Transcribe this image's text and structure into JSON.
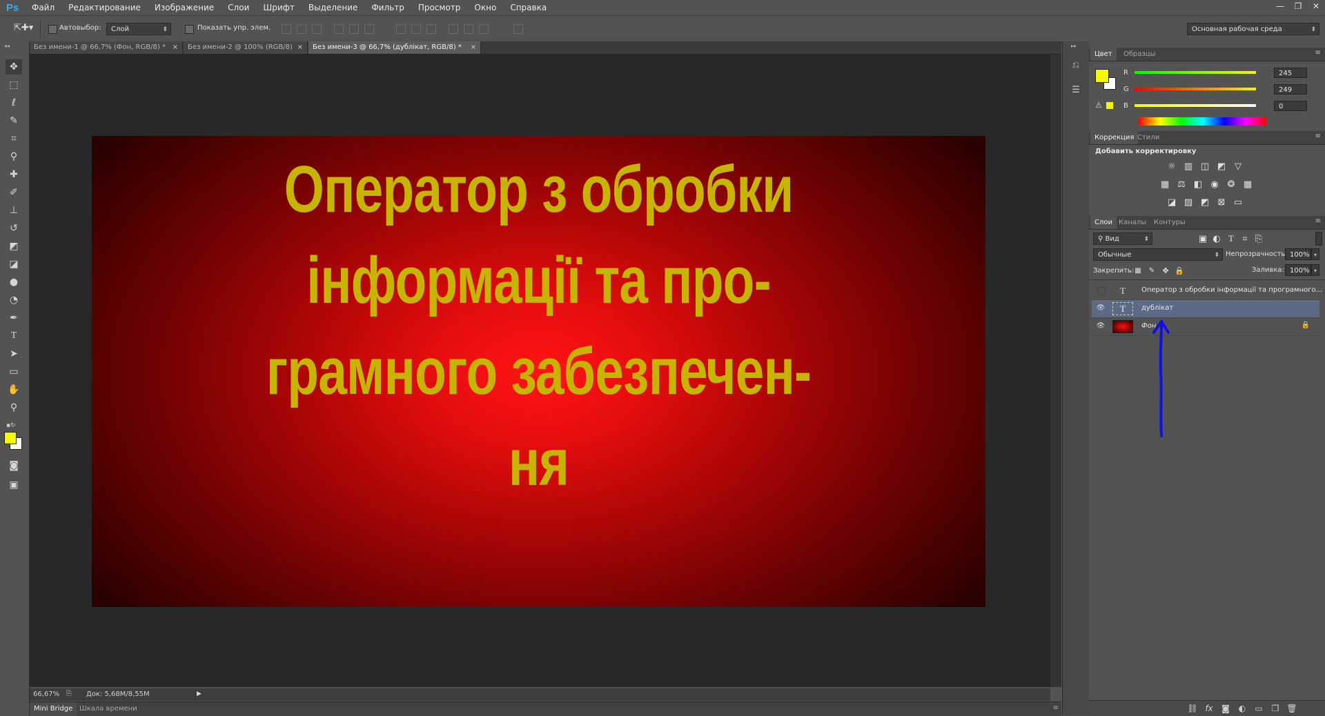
{
  "app": {
    "logo": "Ps"
  },
  "menu": [
    "Файл",
    "Редактирование",
    "Изображение",
    "Слои",
    "Шрифт",
    "Выделение",
    "Фильтр",
    "Просмотр",
    "Окно",
    "Справка"
  ],
  "window_controls": {
    "minimize": "—",
    "restore": "❐",
    "close": "✕"
  },
  "options": {
    "autoselect_label": "Автовыбор:",
    "autoselect_value": "Слой",
    "show_transform_label": "Показать упр. элем.",
    "workspace": "Основная рабочая среда"
  },
  "doc_tabs": [
    {
      "label": "Без имени-1 @ 66,7% (Фон, RGB/8) *",
      "close": "×"
    },
    {
      "label": "Без имени-2 @ 100% (RGB/8)",
      "close": "×"
    },
    {
      "label": "Без имени-3 @ 66,7% (дублікат, RGB/8) *",
      "close": "×"
    }
  ],
  "canvas_text": [
    "Оператор з обробки",
    "інформації та про-",
    "грамного забезпечен-",
    "ня"
  ],
  "status": {
    "zoom": "66,67%",
    "doc": "Док: 5,68M/8,55M"
  },
  "bottom_tabs": [
    "Mini Bridge",
    "Шкала времени"
  ],
  "panels": {
    "color": {
      "tabs": [
        "Цвет",
        "Образцы"
      ],
      "channels": [
        {
          "label": "R",
          "value": "245"
        },
        {
          "label": "G",
          "value": "249"
        },
        {
          "label": "B",
          "value": "0"
        }
      ],
      "fg_color": "#f5f900",
      "bg_color": "#ffffff"
    },
    "adjustments": {
      "tabs": [
        "Коррекция",
        "Стили"
      ],
      "title": "Добавить корректировку"
    },
    "layers": {
      "tabs": [
        "Слои",
        "Каналы",
        "Контуры"
      ],
      "filter": "Вид",
      "blend_mode": "Обычные",
      "opacity_label": "Непрозрачность:",
      "opacity_value": "100%",
      "lock_label": "Закрепить:",
      "fill_label": "Заливка:",
      "fill_value": "100%",
      "items": [
        {
          "name": "Оператор з обробки інформації та програмного...",
          "type": "text",
          "visible": false,
          "selected": false
        },
        {
          "name": "дублікат",
          "type": "text",
          "visible": true,
          "selected": true
        },
        {
          "name": "Фон",
          "type": "image",
          "visible": true,
          "selected": false,
          "locked": true
        }
      ]
    }
  },
  "annotation": {
    "arrow_color": "#1010e0"
  },
  "colors": {
    "accent_text": "#c7b400",
    "selected_layer": "#5d6a86"
  }
}
